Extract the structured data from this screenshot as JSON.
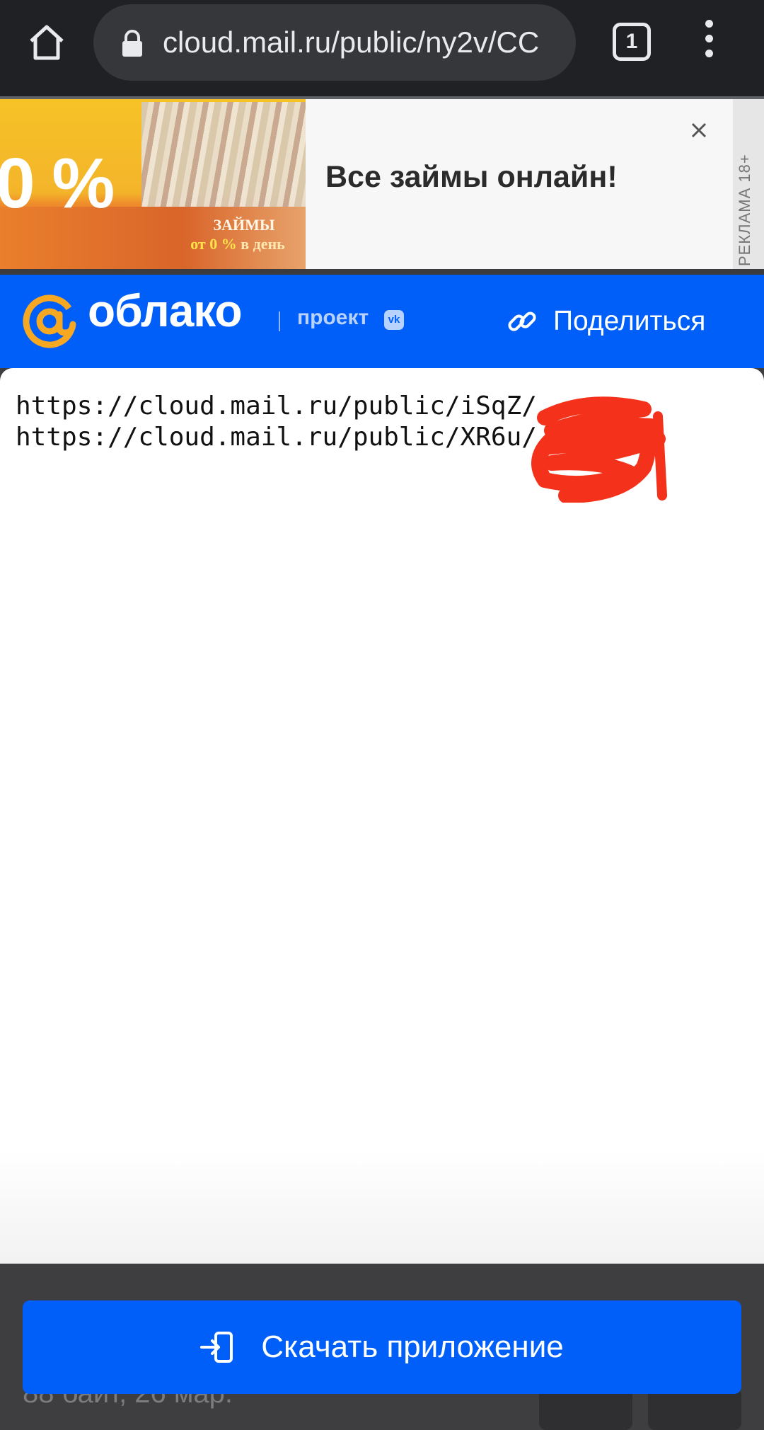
{
  "browser": {
    "url": "cloud.mail.ru/public/ny2v/CC",
    "tab_count": "1",
    "icons": [
      "home-icon",
      "lock-icon",
      "tabs-icon",
      "more-vert-icon"
    ]
  },
  "ad": {
    "image_percent": "0 %",
    "image_loans": "ЗАЙМЫ",
    "image_rate_prefix": "от 0 %",
    "image_rate_suffix": " в день",
    "headline": "Все займы онлайн!",
    "label": "РЕКЛАМА 18+"
  },
  "header": {
    "logo_text": "облако",
    "project_label": "проект",
    "vk_badge": "vk",
    "share_label": "Поделиться"
  },
  "document": {
    "lines": [
      "https://cloud.mail.ru/public/iSqZ/",
      "https://cloud.mail.ru/public/XR6u/"
    ]
  },
  "footer": {
    "file_info": "88 байт, 26 мар.",
    "download_label": "Скачать приложение"
  },
  "colors": {
    "brand_blue": "#005ff9",
    "logo_orange": "#f7a823",
    "redaction_red": "#f4321b",
    "toolbar_dark": "#202124"
  }
}
